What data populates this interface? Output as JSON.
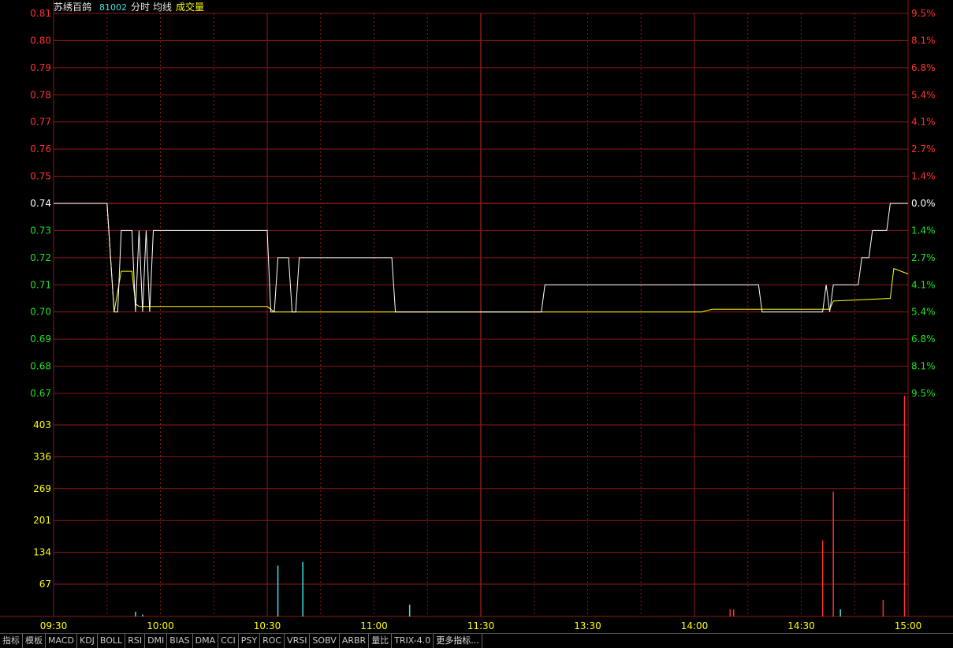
{
  "header": {
    "stock_name": "苏绣百鸽",
    "stock_code": "81002",
    "mode_label": "分时",
    "avg_label": "均线",
    "vol_label": "成交量"
  },
  "colors": {
    "background": "#000000",
    "grid": "#8c1a1a",
    "up": "#ff3030",
    "down": "#20e020",
    "neutral": "#ffffff",
    "price_line": "#ffffff",
    "avg_line": "#ffff00",
    "vol_label": "#ffff00",
    "vol_up_bar": "#ff3030",
    "vol_down_bar": "#40e0e0",
    "time_label": "#ffff00"
  },
  "chart_data": {
    "type": "line",
    "price_axis": {
      "ticks": [
        "0.81",
        "0.80",
        "0.79",
        "0.78",
        "0.77",
        "0.76",
        "0.75",
        "0.74",
        "0.73",
        "0.72",
        "0.71",
        "0.70",
        "0.69",
        "0.68",
        "0.67"
      ],
      "ylim": [
        0.67,
        0.81
      ],
      "reference": 0.74
    },
    "pct_axis": {
      "ticks": [
        "9.5%",
        "8.1%",
        "6.8%",
        "5.4%",
        "4.1%",
        "2.7%",
        "1.4%",
        "0.0%",
        "1.4%",
        "2.7%",
        "4.1%",
        "5.4%",
        "6.8%",
        "8.1%",
        "9.5%"
      ]
    },
    "volume_axis": {
      "ticks": [
        "403",
        "336",
        "269",
        "201",
        "134",
        "67"
      ],
      "ylim": [
        0,
        470
      ]
    },
    "x_ticks": [
      "09:30",
      "10:00",
      "10:30",
      "11:00",
      "11:30",
      "13:30",
      "14:00",
      "14:30",
      "15:00"
    ],
    "price": [
      [
        0,
        0.74
      ],
      [
        15,
        0.74
      ],
      [
        17,
        0.7
      ],
      [
        18,
        0.7
      ],
      [
        19,
        0.73
      ],
      [
        22,
        0.73
      ],
      [
        23,
        0.7
      ],
      [
        24,
        0.73
      ],
      [
        25,
        0.7
      ],
      [
        26,
        0.73
      ],
      [
        27,
        0.7
      ],
      [
        28,
        0.73
      ],
      [
        60,
        0.73
      ],
      [
        61,
        0.7
      ],
      [
        62,
        0.7
      ],
      [
        63,
        0.72
      ],
      [
        66,
        0.72
      ],
      [
        67,
        0.7
      ],
      [
        68,
        0.7
      ],
      [
        69,
        0.72
      ],
      [
        95,
        0.72
      ],
      [
        96,
        0.7
      ],
      [
        137,
        0.7
      ],
      [
        138,
        0.71
      ],
      [
        198,
        0.71
      ],
      [
        199,
        0.7
      ],
      [
        216,
        0.7
      ],
      [
        217,
        0.71
      ],
      [
        218,
        0.7
      ],
      [
        219,
        0.71
      ],
      [
        226,
        0.71
      ],
      [
        227,
        0.72
      ],
      [
        229,
        0.72
      ],
      [
        230,
        0.73
      ],
      [
        234,
        0.73
      ],
      [
        235,
        0.74
      ],
      [
        240,
        0.74
      ]
    ],
    "average": [
      [
        0,
        0.74
      ],
      [
        15,
        0.74
      ],
      [
        17,
        0.7
      ],
      [
        19,
        0.715
      ],
      [
        22,
        0.715
      ],
      [
        23,
        0.703
      ],
      [
        24,
        0.702
      ],
      [
        28,
        0.702
      ],
      [
        60,
        0.702
      ],
      [
        62,
        0.7
      ],
      [
        70,
        0.7
      ],
      [
        182,
        0.7
      ],
      [
        185,
        0.701
      ],
      [
        218,
        0.701
      ],
      [
        219,
        0.704
      ],
      [
        235,
        0.705
      ],
      [
        236,
        0.716
      ],
      [
        240,
        0.714
      ]
    ],
    "volume": [
      {
        "t": 23,
        "v": 10,
        "dir": "down"
      },
      {
        "t": 25,
        "v": 4,
        "dir": "down"
      },
      {
        "t": 63,
        "v": 107,
        "dir": "down"
      },
      {
        "t": 70,
        "v": 115,
        "dir": "down"
      },
      {
        "t": 100,
        "v": 25,
        "dir": "down"
      },
      {
        "t": 190,
        "v": 15,
        "dir": "up"
      },
      {
        "t": 191,
        "v": 15,
        "dir": "up"
      },
      {
        "t": 216,
        "v": 160,
        "dir": "up"
      },
      {
        "t": 219,
        "v": 263,
        "dir": "up"
      },
      {
        "t": 221,
        "v": 15,
        "dir": "down"
      },
      {
        "t": 233,
        "v": 35,
        "dir": "up"
      },
      {
        "t": 239,
        "v": 465,
        "dir": "up"
      }
    ]
  },
  "toolbar": {
    "items": [
      "指标",
      "模板",
      "MACD",
      "KDJ",
      "BOLL",
      "RSI",
      "DMI",
      "BIAS",
      "DMA",
      "CCI",
      "PSY",
      "ROC",
      "VRSI",
      "SOBV",
      "ARBR",
      "量比",
      "TRIX-4.0",
      "更多指标..."
    ]
  }
}
